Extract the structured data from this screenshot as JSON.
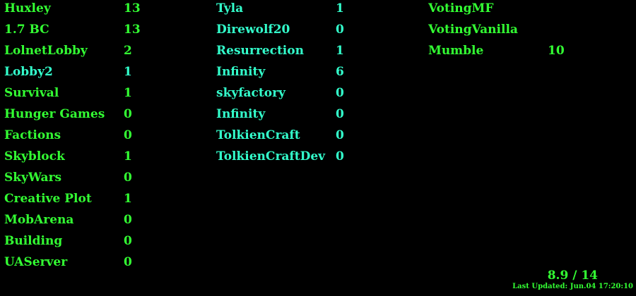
{
  "colors": {
    "background": "#000000",
    "server_green": "#33ff33",
    "server_cyan": "#33ffcc"
  },
  "columns": [
    {
      "color": "#33ff33",
      "servers": [
        {
          "name": "Huxley",
          "count": "13"
        },
        {
          "name": "1.7 BC",
          "count": "13"
        },
        {
          "name": "LolnetLobby",
          "count": "2"
        },
        {
          "name": "Lobby2",
          "count": "1",
          "color": "#33ffcc"
        },
        {
          "name": "Survival",
          "count": "1"
        },
        {
          "name": "Hunger Games",
          "count": "0"
        },
        {
          "name": "Factions",
          "count": "0"
        },
        {
          "name": "Skyblock",
          "count": "1"
        },
        {
          "name": "SkyWars",
          "count": "0"
        },
        {
          "name": "Creative Plot",
          "count": "1"
        },
        {
          "name": "MobArena",
          "count": "0"
        },
        {
          "name": "Building",
          "count": "0"
        },
        {
          "name": "UAServer",
          "count": "0"
        }
      ]
    },
    {
      "color": "#33ffcc",
      "servers": [
        {
          "name": "Tyla",
          "count": "1"
        },
        {
          "name": "Direwolf20",
          "count": "0"
        },
        {
          "name": "Resurrection",
          "count": "1"
        },
        {
          "name": "Infinity",
          "count": "6"
        },
        {
          "name": "skyfactory",
          "count": "0"
        },
        {
          "name": "Infinity",
          "count": "0"
        },
        {
          "name": "TolkienCraft",
          "count": "0"
        },
        {
          "name": "TolkienCraftDev",
          "count": "0"
        }
      ]
    },
    {
      "color": "#33ff33",
      "servers": [
        {
          "name": "VotingMF",
          "count": ""
        },
        {
          "name": "VotingVanilla",
          "count": ""
        },
        {
          "name": "Mumble",
          "count": "10"
        }
      ]
    }
  ],
  "status": {
    "load": "8.9 / 14",
    "last_updated": "Last Updated: Jun.04 17:20:10"
  }
}
